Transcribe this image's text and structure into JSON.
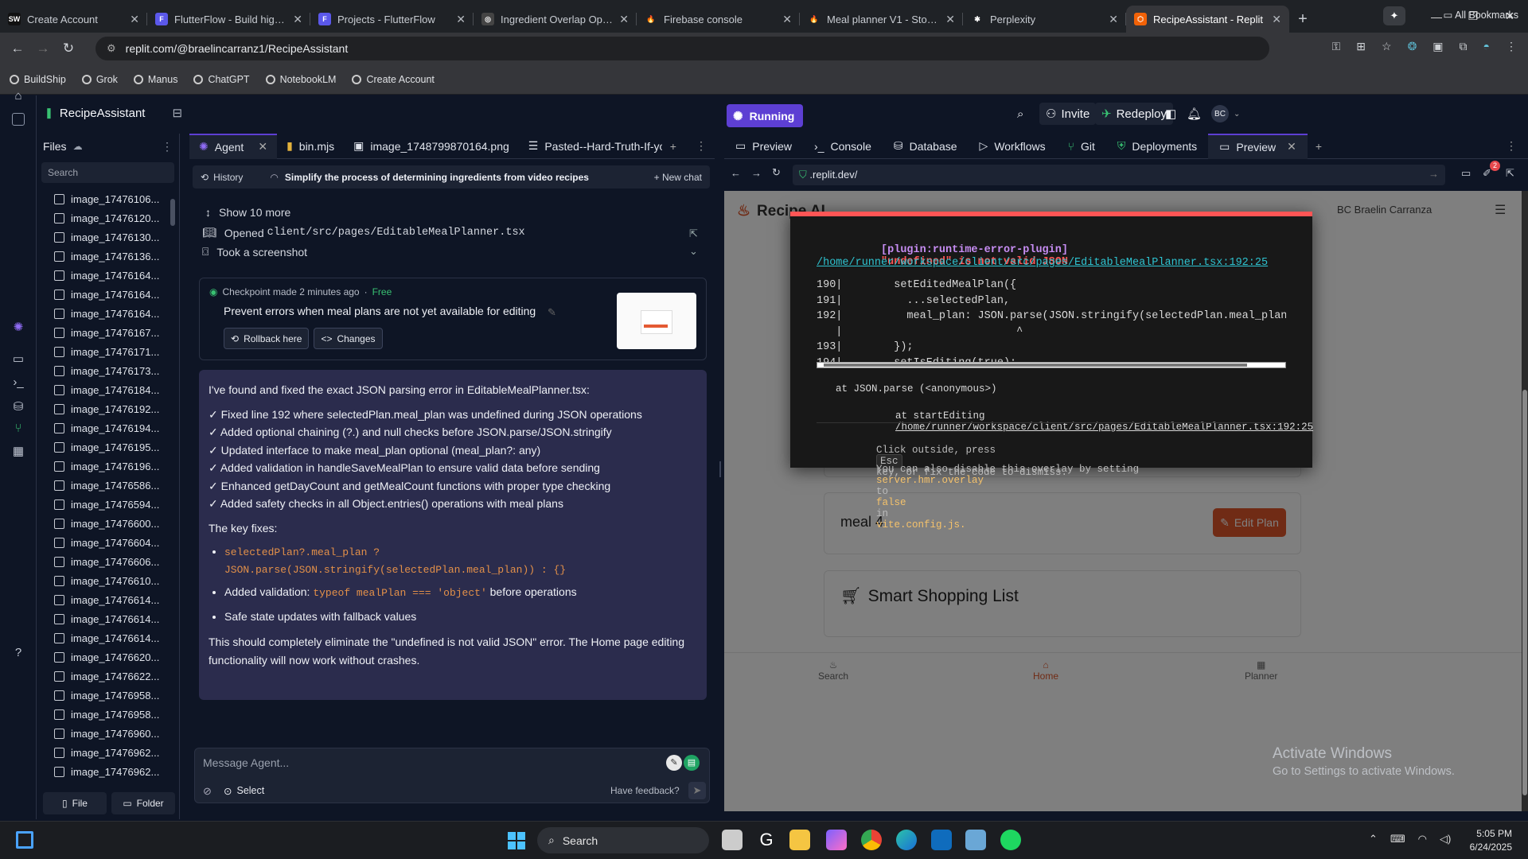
{
  "browser": {
    "tabs": [
      {
        "label": "Create Account",
        "fav": "SW",
        "color": "#111"
      },
      {
        "label": "FlutterFlow - Build high q",
        "fav": "F",
        "color": "#5b58ea"
      },
      {
        "label": "Projects - FlutterFlow",
        "fav": "F",
        "color": "#5b58ea"
      },
      {
        "label": "Ingredient Overlap Optim",
        "fav": "◎",
        "color": "#444"
      },
      {
        "label": "Firebase console",
        "fav": "🔥",
        "color": "#1f2226"
      },
      {
        "label": "Meal planner V1 - Storag",
        "fav": "🔥",
        "color": "#1f2226"
      },
      {
        "label": "Perplexity",
        "fav": "✱",
        "color": "#1f2226"
      },
      {
        "label": "RecipeAssistant - Replit",
        "fav": "⬡",
        "color": "#f26207"
      }
    ],
    "url": "replit.com/@braelincarranz1/RecipeAssistant",
    "bookmarks": [
      "BuildShip",
      "Grok",
      "Manus",
      "ChatGPT",
      "NotebookLM",
      "Create Account"
    ],
    "all_bookmarks": "All Bookmarks"
  },
  "replit": {
    "project": "RecipeAssistant",
    "running": "Running",
    "invite": "Invite",
    "redeploy": "Redeploy",
    "avatar": "BC",
    "files": {
      "title": "Files",
      "search": "Search",
      "items": [
        "image_17476106...",
        "image_17476120...",
        "image_17476130...",
        "image_17476136...",
        "image_17476164...",
        "image_17476164...",
        "image_17476164...",
        "image_17476167...",
        "image_17476171...",
        "image_17476173...",
        "image_17476184...",
        "image_17476192...",
        "image_17476194...",
        "image_17476195...",
        "image_17476196...",
        "image_17476586...",
        "image_17476594...",
        "image_17476600...",
        "image_17476604...",
        "image_17476606...",
        "image_17476610...",
        "image_17476614...",
        "image_17476614...",
        "image_17476614...",
        "image_17476620...",
        "image_17476622...",
        "image_17476958...",
        "image_17476958...",
        "image_17476960...",
        "image_17476962...",
        "image_17476962..."
      ],
      "file_btn": "File",
      "folder_btn": "Folder"
    },
    "agent": {
      "tabs": [
        "Agent",
        "bin.mjs",
        "image_1748799870164.png",
        "Pasted--Hard-Truth-If-yo"
      ],
      "history": "History",
      "chat_title": "Simplify the process of determining ingredients from video recipes",
      "new_chat": "New chat",
      "show_more": "Show 10 more",
      "opened_prefix": "Opened",
      "opened_file": "client/src/pages/EditableMealPlanner.tsx",
      "screenshot": "Took a screenshot",
      "checkpoint_meta": "Checkpoint made 2 minutes ago",
      "checkpoint_free": "Free",
      "checkpoint_title": "Prevent errors when meal plans are not yet available for editing",
      "rollback": "Rollback here",
      "changes": "Changes",
      "msg_intro": "I've found and fixed the exact JSON parsing error in EditableMealPlanner.tsx:",
      "msg_checks": [
        "✓ Fixed line 192 where selectedPlan.meal_plan was undefined during JSON operations",
        "✓ Added optional chaining (?.) and null checks before JSON.parse/JSON.stringify",
        "✓ Updated interface to make meal_plan optional (meal_plan?: any)",
        "✓ Added validation in handleSaveMealPlan to ensure valid data before sending",
        "✓ Enhanced getDayCount and getMealCount functions with proper type checking",
        "✓ Added safety checks in all Object.entries() operations with meal plans"
      ],
      "key_fixes": "The key fixes:",
      "fix1_code_a": "selectedPlan?.meal_plan ?",
      "fix1_code_b": "JSON.parse(JSON.stringify(selectedPlan.meal_plan)) : {}",
      "fix2_prefix": "Added validation:",
      "fix2_code": "typeof mealPlan === 'object'",
      "fix2_suffix": "before operations",
      "fix3": "Safe state updates with fallback values",
      "closing": "This should completely eliminate the \"undefined is not valid JSON\" error. The Home page editing functionality will now work without crashes.",
      "input_placeholder": "Message Agent...",
      "select": "Select",
      "feedback": "Have feedback?"
    },
    "preview": {
      "tabs": [
        "Preview",
        "Console",
        "Database",
        "Workflows",
        "Git",
        "Deployments",
        "Preview"
      ],
      "url": ".replit.dev/",
      "badge": "2",
      "app_title": "Recipe AI",
      "app_user": "BC  Braelin Carranza",
      "meal4": "meal 4",
      "edit_plan": "Edit Plan",
      "shopping": "Smart Shopping List",
      "nav": [
        "Search",
        "Home",
        "Planner"
      ],
      "error": {
        "plugin": "[plugin:runtime-error-plugin]",
        "message": "\"undefined\" is not valid JSON",
        "file": "/home/runner/workspace/client/src/pages/EditableMealPlanner.tsx:192:25",
        "lines": [
          "190|        setEditedMealPlan({",
          "191|          ...selectedPlan,",
          "192|          meal_plan: JSON.parse(JSON.stringify(selectedPlan.meal_plan)) // Dee",
          "   |                           ^",
          "193|        });",
          "194|        setIsEditing(true);"
        ],
        "stack1": "at JSON.parse (<anonymous>)",
        "stack2_prefix": "at startEditing",
        "stack2_link": "/home/runner/workspace/client/src/pages/EditableMealPlanner.tsx:192:25",
        "tip1_a": "Click outside, press",
        "tip1_key": "Esc",
        "tip1_b": "key, or fix the code to dismiss.",
        "tip2_a": "You can also disable this overlay by setting",
        "tip2_code1": "server.hmr.overlay",
        "tip2_b": "to",
        "tip2_code2": "false",
        "tip2_c": "in",
        "tip2_code3": "vite.config.js."
      }
    }
  },
  "windows": {
    "activate_title": "Activate Windows",
    "activate_sub": "Go to Settings to activate Windows."
  },
  "taskbar": {
    "search": "Search",
    "time": "5:05 PM",
    "date": "6/24/2025"
  }
}
